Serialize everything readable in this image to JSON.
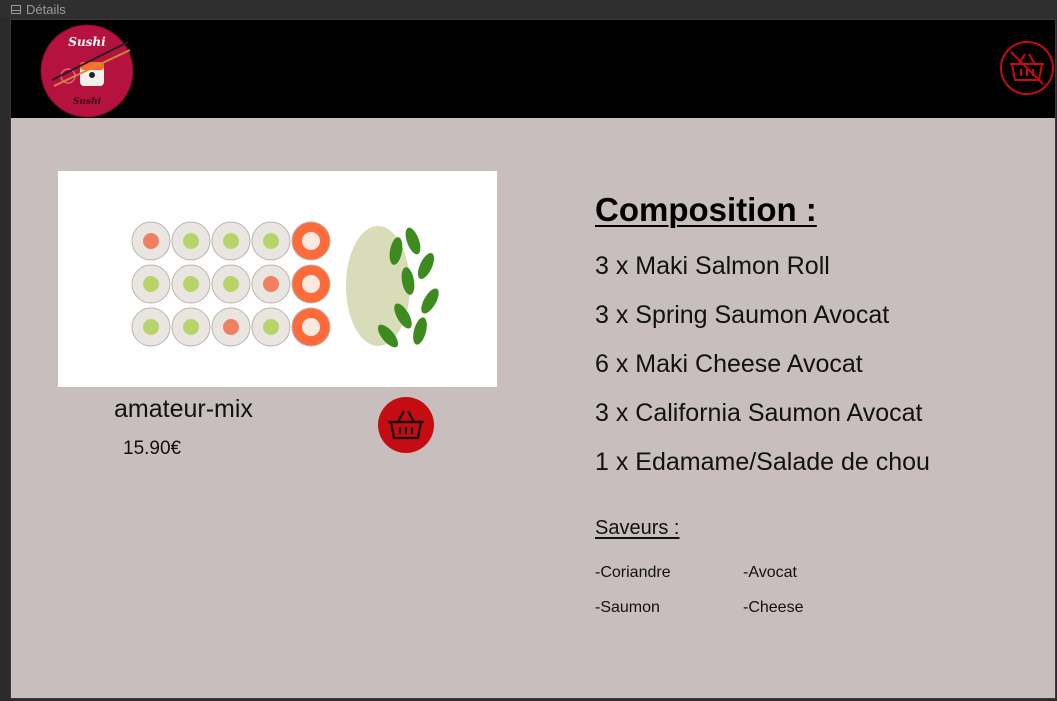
{
  "window": {
    "title": "Détails"
  },
  "header": {
    "logo_text": "Sushi",
    "logo_text_bottom": "Sushi"
  },
  "product": {
    "name": "amateur-mix",
    "price": "15.90€"
  },
  "composition": {
    "title": "Composition :",
    "items": [
      "3 x Maki Salmon Roll",
      "3 x Spring Saumon Avocat",
      "6 x Maki Cheese Avocat",
      "3 x California Saumon Avocat",
      "1 x Edamame/Salade de chou"
    ]
  },
  "flavors": {
    "title": "Saveurs :",
    "items": [
      "-Coriandre",
      "-Avocat",
      "-Saumon",
      "-Cheese"
    ]
  },
  "colors": {
    "accent": "#c40c12",
    "logo_bg": "#b5123f",
    "panel": "#c8bebd",
    "header": "#000000"
  },
  "icons": {
    "cart": "basket-icon",
    "window": "window-frame-icon"
  }
}
